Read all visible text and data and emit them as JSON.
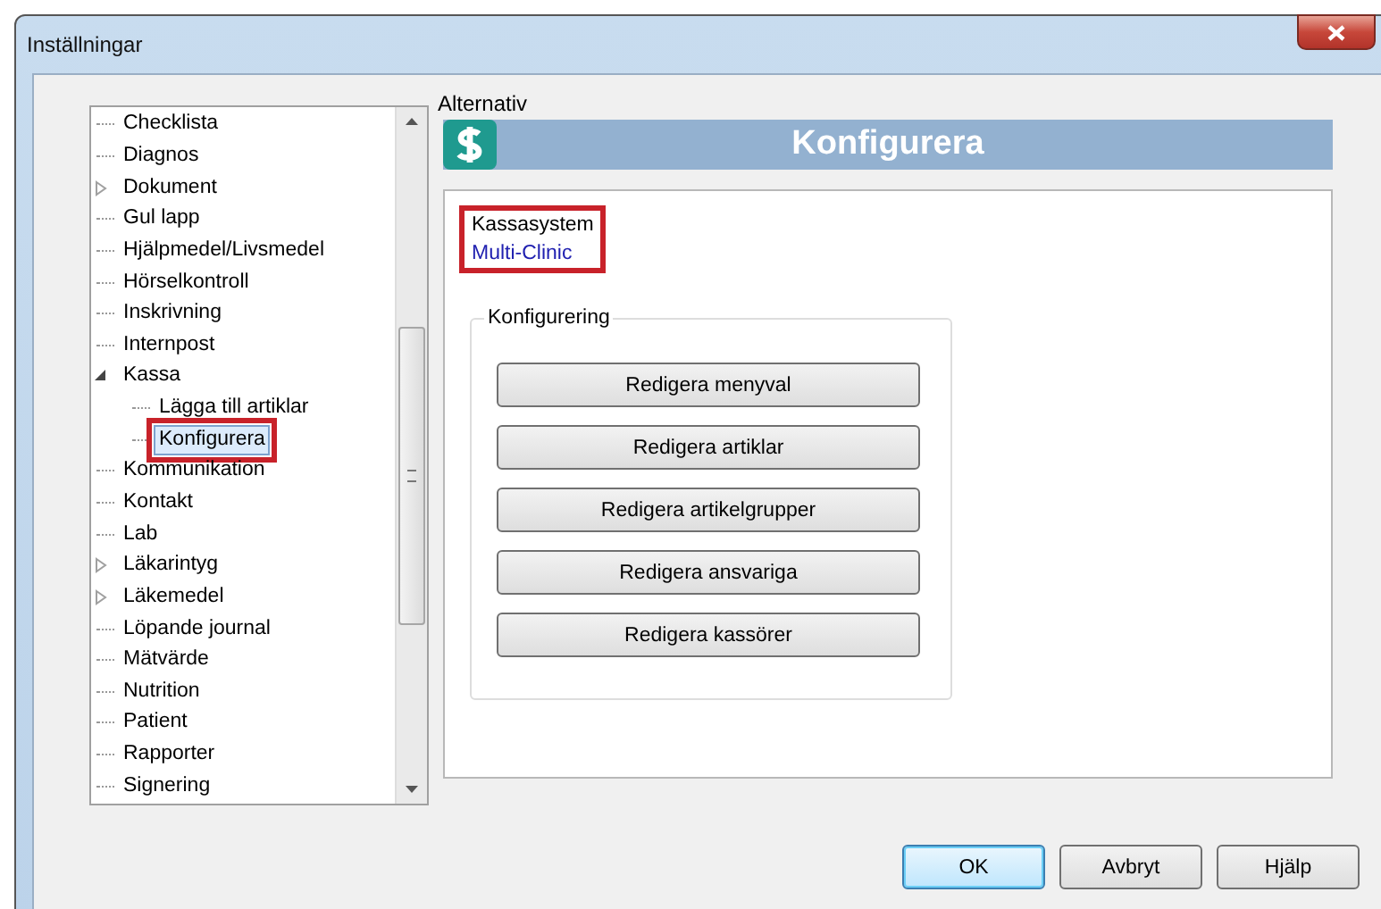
{
  "window": {
    "title": "Inställningar"
  },
  "tree": {
    "items": [
      {
        "label": "Checklista",
        "kind": "leaf",
        "selected": false,
        "highlighted": false
      },
      {
        "label": "Diagnos",
        "kind": "leaf",
        "selected": false,
        "highlighted": false
      },
      {
        "label": "Dokument",
        "kind": "collapsed",
        "selected": false,
        "highlighted": false
      },
      {
        "label": "Gul lapp",
        "kind": "leaf",
        "selected": false,
        "highlighted": false
      },
      {
        "label": "Hjälpmedel/Livsmedel",
        "kind": "leaf",
        "selected": false,
        "highlighted": false
      },
      {
        "label": "Hörselkontroll",
        "kind": "leaf",
        "selected": false,
        "highlighted": false
      },
      {
        "label": "Inskrivning",
        "kind": "leaf",
        "selected": false,
        "highlighted": false
      },
      {
        "label": "Internpost",
        "kind": "leaf",
        "selected": false,
        "highlighted": false
      },
      {
        "label": "Kassa",
        "kind": "expanded",
        "selected": false,
        "highlighted": false,
        "children": [
          {
            "label": "Lägga till artiklar",
            "kind": "leaf",
            "selected": false,
            "highlighted": false
          },
          {
            "label": "Konfigurera",
            "kind": "leaf",
            "selected": true,
            "highlighted": true
          }
        ]
      },
      {
        "label": "Kommunikation",
        "kind": "leaf",
        "selected": false,
        "highlighted": false
      },
      {
        "label": "Kontakt",
        "kind": "leaf",
        "selected": false,
        "highlighted": false
      },
      {
        "label": "Lab",
        "kind": "leaf",
        "selected": false,
        "highlighted": false
      },
      {
        "label": "Läkarintyg",
        "kind": "collapsed",
        "selected": false,
        "highlighted": false
      },
      {
        "label": "Läkemedel",
        "kind": "collapsed",
        "selected": false,
        "highlighted": false
      },
      {
        "label": "Löpande journal",
        "kind": "leaf",
        "selected": false,
        "highlighted": false
      },
      {
        "label": "Mätvärde",
        "kind": "leaf",
        "selected": false,
        "highlighted": false
      },
      {
        "label": "Nutrition",
        "kind": "leaf",
        "selected": false,
        "highlighted": false
      },
      {
        "label": "Patient",
        "kind": "leaf",
        "selected": false,
        "highlighted": false
      },
      {
        "label": "Rapporter",
        "kind": "leaf",
        "selected": false,
        "highlighted": false
      },
      {
        "label": "Signering",
        "kind": "leaf",
        "selected": false,
        "highlighted": false
      }
    ]
  },
  "options": {
    "group_label": "Alternativ",
    "header_title": "Konfigurera",
    "cash_system": {
      "label": "Kassasystem",
      "value": "Multi-Clinic",
      "highlighted": true
    },
    "configuration": {
      "group_label": "Konfigurering",
      "buttons": [
        "Redigera menyval",
        "Redigera artiklar",
        "Redigera artikelgrupper",
        "Redigera ansvariga",
        "Redigera kassörer"
      ]
    }
  },
  "buttons": [
    {
      "label": "OK",
      "default": true
    },
    {
      "label": "Avbryt",
      "default": false
    },
    {
      "label": "Hjälp",
      "default": false
    }
  ]
}
